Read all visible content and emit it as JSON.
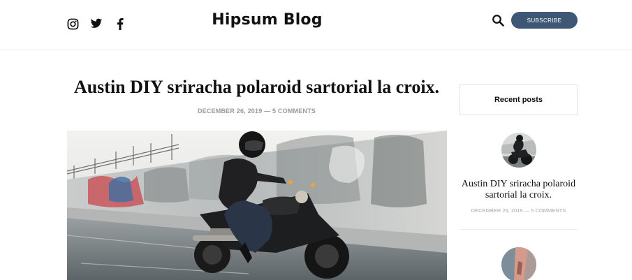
{
  "header": {
    "brand": "Hipsum Blog",
    "social_icons": [
      "instagram-icon",
      "twitter-icon",
      "facebook-icon"
    ],
    "subscribe_label": "SUBSCRIBE",
    "accent_color": "#3e5775"
  },
  "post": {
    "title": "Austin DIY sriracha polaroid sartorial la croix.",
    "meta": "DECEMBER 26, 2019 — 5 COMMENTS"
  },
  "sidebar": {
    "heading": "Recent posts",
    "items": [
      {
        "title": "Austin DIY sriracha polaroid sartorial la croix.",
        "meta": "DECEMBER 26, 2019 — 5 COMMENTS"
      }
    ]
  }
}
